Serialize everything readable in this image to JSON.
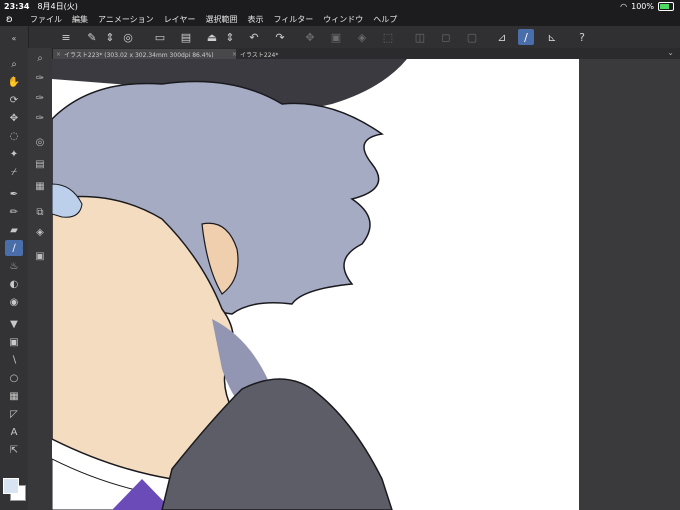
{
  "status": {
    "time": "23:34",
    "date": "8月4日(火)",
    "battery": "100%",
    "battery_level": 1.0
  },
  "menu": [
    "ファイル",
    "編集",
    "アニメーション",
    "レイヤー",
    "選択範囲",
    "表示",
    "フィルター",
    "ウィンドウ",
    "ヘルプ"
  ],
  "tabs": [
    {
      "label": "イラスト223* (303.02 x 302.34mm 300dpi 86.4%)",
      "active": true
    },
    {
      "label": "イラスト224*",
      "active": false
    }
  ],
  "colors": {
    "accent": "#4a6ea9",
    "main_color": "#d8e4f2",
    "sub_color": "#ffffff"
  },
  "icons": {
    "toolbar": [
      "menu-icon",
      "new-file-icon",
      "chevron-updown-icon",
      "clip-studio-icon",
      "new-canvas-icon",
      "open-folder-icon",
      "save-icon",
      "chevron-updown-icon",
      "undo-icon",
      "redo-icon",
      "transform-icon",
      "clear-icon",
      "fill-icon",
      "select-all-icon",
      "deselect-icon",
      "crop-icon",
      "ruler-icon",
      "pen-active-icon",
      "smooth-icon",
      "quick-help-icon"
    ],
    "left": [
      "zoom-icon",
      "hand-icon",
      "rotate-icon",
      "move-icon",
      "lasso-icon",
      "magic-wand-icon",
      "eyedropper-icon",
      "pen-icon",
      "pencil-icon",
      "brush-icon",
      "airbrush-icon",
      "eraser-icon",
      "blend-icon",
      "fill-icon",
      "gradient-icon",
      "figure-icon",
      "frame-icon",
      "text-icon",
      "ruler-icon",
      "balloon-icon",
      "correct-line-icon"
    ]
  }
}
